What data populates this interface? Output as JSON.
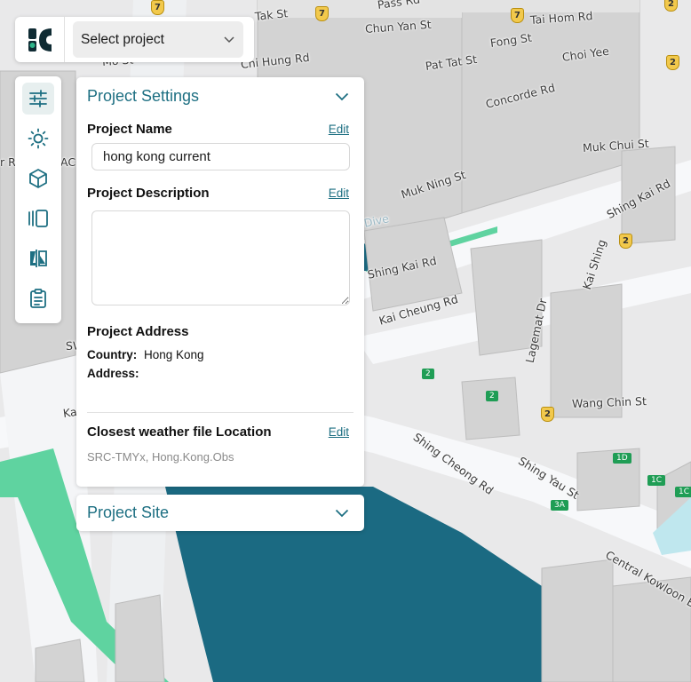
{
  "topbar": {
    "project_select": {
      "label": "Select project",
      "icon": "chevron-down-icon"
    }
  },
  "toolbar": {
    "tools": [
      {
        "name": "settings-sliders-icon",
        "active": true
      },
      {
        "name": "sun-icon",
        "active": false
      },
      {
        "name": "cube-icon",
        "active": false
      },
      {
        "name": "carousel-icon",
        "active": false
      },
      {
        "name": "compare-icon",
        "active": false
      },
      {
        "name": "clipboard-icon",
        "active": false
      }
    ]
  },
  "settings": {
    "title": "Project Settings",
    "name_label": "Project Name",
    "name_edit": "Edit",
    "name_value": "hong kong current",
    "desc_label": "Project Description",
    "desc_edit": "Edit",
    "desc_value": "",
    "address_label": "Project Address",
    "country_key": "Country:",
    "country_value": "Hong Kong",
    "address_key": "Address:",
    "address_value": "",
    "weather_label": "Closest weather file Location",
    "weather_edit": "Edit",
    "weather_value": "SRC-TMYx, Hong.Kong.Obs"
  },
  "site": {
    "title": "Project Site"
  },
  "map": {
    "streets": [
      "Tak St",
      "Pass Rd",
      "Tai Hom Rd",
      "Chun Yan St",
      "Fong St",
      "Choi Yee",
      "Mo St",
      "Chi Hung Rd",
      "Pat Tat St",
      "Concorde Rd",
      "Muk Chui St",
      "Muk Ning St",
      "Shing Kai Rd",
      "Shing Kai Rd",
      "Kai Cheung Rd",
      "Kai Shing",
      "Lagemat Dr",
      "Wang Chin St",
      "Shing Cheong Rd",
      "Shing Yau St",
      "Central Kowloon By",
      "Ka",
      "SW",
      "r Ro",
      "AC",
      "Dive"
    ],
    "shields": [
      "7",
      "7",
      "7",
      "2",
      "2",
      "2",
      "2"
    ],
    "route_badges": [
      "2",
      "2",
      "1D",
      "1C",
      "1C",
      "3A"
    ],
    "colors": {
      "water": "#1b6a82",
      "park": "#5fd3a0",
      "road": "#f7f8fa",
      "building": "#cfcfcf",
      "accent": "#1d6f82"
    }
  }
}
